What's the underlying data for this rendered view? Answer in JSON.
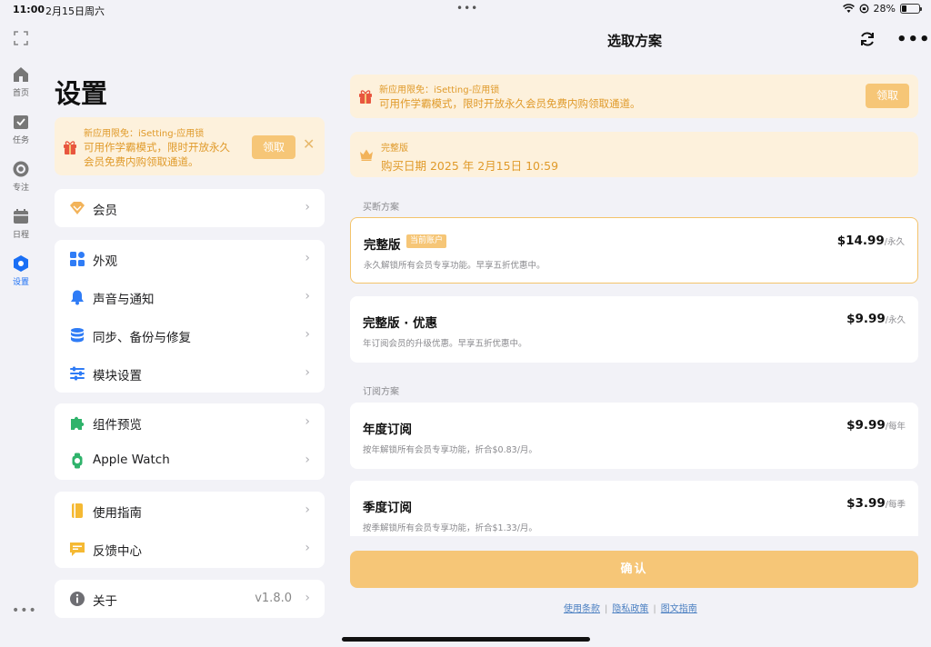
{
  "status_bar": {
    "time": "11:00",
    "date": "2月15日周六",
    "battery": "28%",
    "battery_level": 0.28,
    "dots": "•••"
  },
  "rail": {
    "items": [
      {
        "label": "首页",
        "icon": "home-icon"
      },
      {
        "label": "任务",
        "icon": "task-check-icon"
      },
      {
        "label": "专注",
        "icon": "focus-target-icon"
      },
      {
        "label": "日程",
        "icon": "calendar-icon"
      },
      {
        "label": "设置",
        "icon": "settings-hexagon-icon"
      }
    ],
    "more": "•••"
  },
  "settings": {
    "title": "设置",
    "promo": {
      "title": "新应用限免：iSetting-应用锁",
      "text": "可用作学霸模式，限时开放永久会员免费内购领取通道。",
      "claim": "领取",
      "close": "✕"
    },
    "groups": [
      [
        {
          "label": "会员",
          "icon": "vip-diamond-icon",
          "value": ""
        }
      ],
      [
        {
          "label": "外观",
          "icon": "appearance-grid-icon",
          "value": ""
        },
        {
          "label": "声音与通知",
          "icon": "bell-icon",
          "value": ""
        },
        {
          "label": "同步、备份与修复",
          "icon": "database-icon",
          "value": ""
        },
        {
          "label": "模块设置",
          "icon": "sliders-icon",
          "value": ""
        }
      ],
      [
        {
          "label": "组件预览",
          "icon": "puzzle-icon",
          "value": ""
        },
        {
          "label": "Apple Watch",
          "icon": "watch-icon",
          "value": ""
        }
      ],
      [
        {
          "label": "使用指南",
          "icon": "guide-book-icon",
          "value": ""
        },
        {
          "label": "反馈中心",
          "icon": "feedback-icon",
          "value": ""
        }
      ],
      [
        {
          "label": "关于",
          "icon": "info-icon",
          "value": "v1.8.0"
        }
      ]
    ],
    "chevron": "›"
  },
  "plans_page": {
    "title": "选取方案",
    "more": "•••",
    "promo": {
      "title": "新应用限免：iSetting-应用锁",
      "text": "可用作学霸模式，限时开放永久会员免费内购领取通道。",
      "claim": "领取"
    },
    "owned": {
      "title": "完整版",
      "text": "购买日期 2025 年 2月15日 10:59"
    },
    "buyout_label": "买断方案",
    "subscription_label": "订阅方案",
    "plans": [
      {
        "name": "完整版",
        "badge": "当前账户",
        "desc": "永久解锁所有会员专享功能。早享五折优惠中。",
        "price": "$14.99",
        "period": "/永久",
        "selected": true
      },
      {
        "name": "完整版 · 优惠",
        "badge": "",
        "desc": "年订阅会员的升级优惠。早享五折优惠中。",
        "price": "$9.99",
        "period": "/永久",
        "selected": false
      },
      {
        "name": "年度订阅",
        "badge": "",
        "desc": "按年解锁所有会员专享功能，折合$0.83/月。",
        "price": "$9.99",
        "period": "/每年",
        "selected": false
      },
      {
        "name": "季度订阅",
        "badge": "",
        "desc": "按季解锁所有会员专享功能，折合$1.33/月。",
        "price": "$3.99",
        "period": "/每季",
        "selected": false
      }
    ],
    "confirm": "确认",
    "links": [
      "使用条款",
      "隐私政策",
      "图文指南"
    ],
    "link_sep": "|"
  },
  "colors": {
    "accent": "#f6c677",
    "promo_bg": "#fdf1dc",
    "promo_text": "#e09a2a",
    "active_blue": "#1a6ff5"
  }
}
